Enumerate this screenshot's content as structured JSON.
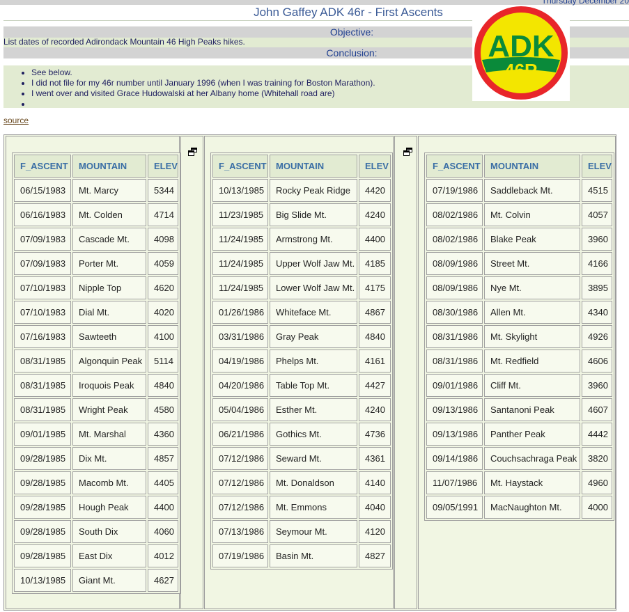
{
  "header": {
    "date_text": "Thursday December 20",
    "title": "John Gaffey ADK 46r - First Ascents"
  },
  "objective": {
    "label": "Objective:",
    "text": "List dates of recorded Adirondack Mountain 46 High Peaks hikes."
  },
  "conclusion": {
    "label": "Conclusion:",
    "items": [
      "See below.",
      "I did not file for my 46r number until January 1996 (when I was training for Boston Marathon).",
      "I went over and visited Grace Hudowalski at her Albany home (Whitehall road are)",
      ""
    ]
  },
  "logo": {
    "line1": "ADK",
    "line2": "46R",
    "colors": {
      "ring": "#e8262a",
      "field": "#f3e600",
      "band": "#0a8a3a"
    }
  },
  "source_link": "source",
  "columns": [
    "F_ASCENT",
    "MOUNTAIN",
    "ELEV"
  ],
  "tables": [
    {
      "rows": [
        [
          "06/15/1983",
          "Mt. Marcy",
          "5344"
        ],
        [
          "06/16/1983",
          "Mt. Colden",
          "4714"
        ],
        [
          "07/09/1983",
          "Cascade Mt.",
          "4098"
        ],
        [
          "07/09/1983",
          "Porter Mt.",
          "4059"
        ],
        [
          "07/10/1983",
          "Nipple Top",
          "4620"
        ],
        [
          "07/10/1983",
          "Dial Mt.",
          "4020"
        ],
        [
          "07/16/1983",
          "Sawteeth",
          "4100"
        ],
        [
          "08/31/1985",
          "Algonquin Peak",
          "5114"
        ],
        [
          "08/31/1985",
          "Iroquois Peak",
          "4840"
        ],
        [
          "08/31/1985",
          "Wright Peak",
          "4580"
        ],
        [
          "09/01/1985",
          "Mt. Marshal",
          "4360"
        ],
        [
          "09/28/1985",
          "Dix Mt.",
          "4857"
        ],
        [
          "09/28/1985",
          "Macomb Mt.",
          "4405"
        ],
        [
          "09/28/1985",
          "Hough Peak",
          "4400"
        ],
        [
          "09/28/1985",
          "South Dix",
          "4060"
        ],
        [
          "09/28/1985",
          "East Dix",
          "4012"
        ],
        [
          "10/13/1985",
          "Giant Mt.",
          "4627"
        ]
      ]
    },
    {
      "rows": [
        [
          "10/13/1985",
          "Rocky Peak Ridge",
          "4420"
        ],
        [
          "11/23/1985",
          "Big Slide Mt.",
          "4240"
        ],
        [
          "11/24/1985",
          "Armstrong Mt.",
          "4400"
        ],
        [
          "11/24/1985",
          "Upper Wolf Jaw Mt.",
          "4185"
        ],
        [
          "11/24/1985",
          "Lower Wolf Jaw Mt.",
          "4175"
        ],
        [
          "01/26/1986",
          "Whiteface Mt.",
          "4867"
        ],
        [
          "03/31/1986",
          "Gray Peak",
          "4840"
        ],
        [
          "04/19/1986",
          "Phelps Mt.",
          "4161"
        ],
        [
          "04/20/1986",
          "Table Top Mt.",
          "4427"
        ],
        [
          "05/04/1986",
          "Esther Mt.",
          "4240"
        ],
        [
          "06/21/1986",
          "Gothics Mt.",
          "4736"
        ],
        [
          "07/12/1986",
          "Seward Mt.",
          "4361"
        ],
        [
          "07/12/1986",
          "Mt. Donaldson",
          "4140"
        ],
        [
          "07/12/1986",
          "Mt. Emmons",
          "4040"
        ],
        [
          "07/13/1986",
          "Seymour Mt.",
          "4120"
        ],
        [
          "07/19/1986",
          "Basin Mt.",
          "4827"
        ]
      ]
    },
    {
      "rows": [
        [
          "07/19/1986",
          "Saddleback Mt.",
          "4515"
        ],
        [
          "08/02/1986",
          "Mt. Colvin",
          "4057"
        ],
        [
          "08/02/1986",
          "Blake Peak",
          "3960"
        ],
        [
          "08/09/1986",
          "Street Mt.",
          "4166"
        ],
        [
          "08/09/1986",
          "Nye Mt.",
          "3895"
        ],
        [
          "08/30/1986",
          "Allen Mt.",
          "4340"
        ],
        [
          "08/31/1986",
          "Mt. Skylight",
          "4926"
        ],
        [
          "08/31/1986",
          "Mt. Redfield",
          "4606"
        ],
        [
          "09/01/1986",
          "Cliff Mt.",
          "3960"
        ],
        [
          "09/13/1986",
          "Santanoni Peak",
          "4607"
        ],
        [
          "09/13/1986",
          "Panther Peak",
          "4442"
        ],
        [
          "09/14/1986",
          "Couchsachraga Peak",
          "3820"
        ],
        [
          "11/07/1986",
          "Mt. Haystack",
          "4960"
        ],
        [
          "09/05/1991",
          "MacNaughton Mt.",
          "4000"
        ]
      ]
    }
  ]
}
